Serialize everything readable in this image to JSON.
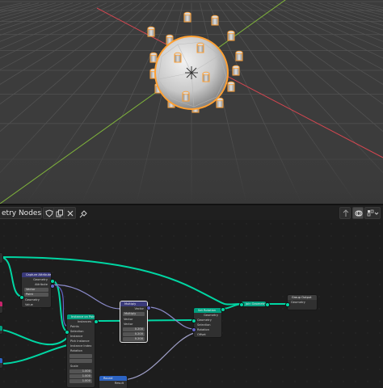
{
  "node_editor": {
    "tree_name": "etry Nodes"
  },
  "nodes": {
    "capture_attribute": {
      "title": "Capture Attribute",
      "rows": [
        "Geometry",
        "Attribute",
        "Vector",
        "Point",
        "Geometry",
        "Value"
      ]
    },
    "instance_on_points": {
      "title": "Instance on Points",
      "rows": [
        "Instances",
        "Points",
        "Selection",
        "Instance",
        "Pick Instance",
        "Instance Index",
        "Rotation",
        "Scale"
      ]
    },
    "multiply": {
      "title": "Multiply",
      "rows": [
        "Vector",
        "Multiply",
        "Vector",
        "Vector"
      ]
    },
    "set_rotation": {
      "title": "Set Rotation",
      "rows": [
        "Geometry",
        "Geometry",
        "Selection",
        "Rotation",
        "Offset"
      ]
    },
    "join_geometry": {
      "title": "Join Geometry",
      "rows": [
        "Geometry"
      ]
    },
    "group_output": {
      "title": "Group Output",
      "rows": [
        "Geometry"
      ]
    },
    "mesh_node": {
      "title": "Round",
      "rows": [
        "Result"
      ]
    }
  },
  "field_values": {
    "multiply_a": "0.200",
    "multiply_b": "0.200",
    "multiply_c": "0.200",
    "scale_x": "1.000",
    "scale_y": "1.000",
    "scale_z": "1.000"
  },
  "colors": {
    "geometry_link": "#00d6a3",
    "vector_link": "#6363c7",
    "selection": "#ffa033",
    "grid_x_axis": "#d24650",
    "grid_y_axis": "#7fb33b"
  }
}
